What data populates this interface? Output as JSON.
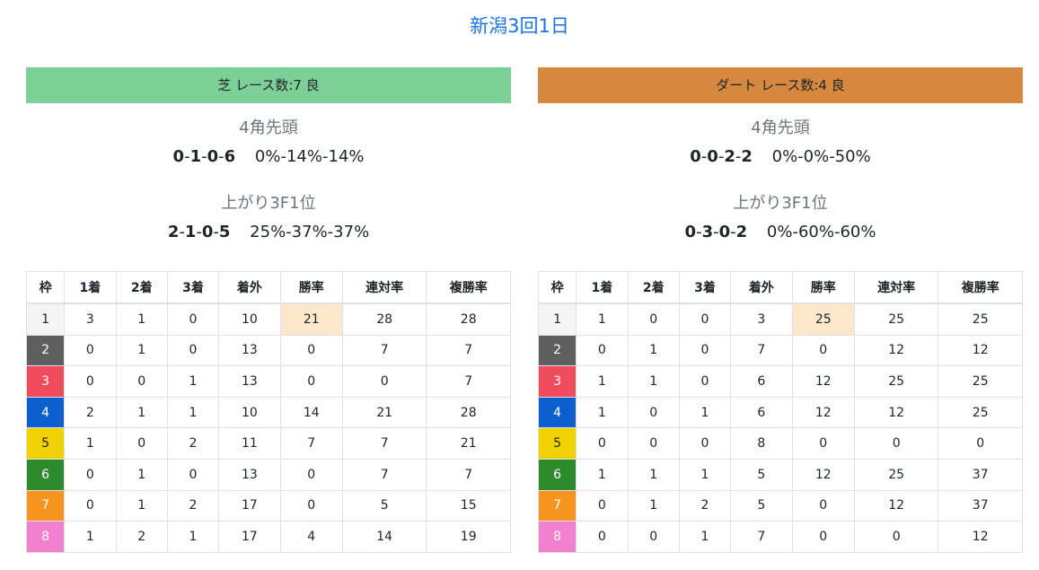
{
  "page": {
    "title": "新潟3回1日"
  },
  "turf": {
    "header": "芝 レース数:7  良",
    "corner_label": "4角先頭",
    "corner_record": [
      "0",
      "1",
      "0",
      "6"
    ],
    "corner_pct": "0%-14%-14%",
    "last3f_label": "上がり3F1位",
    "last3f_record": [
      "2",
      "1",
      "0",
      "5"
    ],
    "last3f_pct": "25%-37%-37%",
    "columns": [
      "枠",
      "1着",
      "2着",
      "3着",
      "着外",
      "勝率",
      "連対率",
      "複勝率"
    ],
    "rows": [
      [
        "1",
        "3",
        "1",
        "0",
        "10",
        "21",
        "28",
        "28"
      ],
      [
        "2",
        "0",
        "1",
        "0",
        "13",
        "0",
        "7",
        "7"
      ],
      [
        "3",
        "0",
        "0",
        "1",
        "13",
        "0",
        "0",
        "7"
      ],
      [
        "4",
        "2",
        "1",
        "1",
        "10",
        "14",
        "21",
        "28"
      ],
      [
        "5",
        "1",
        "0",
        "2",
        "11",
        "7",
        "7",
        "21"
      ],
      [
        "6",
        "0",
        "1",
        "0",
        "13",
        "0",
        "7",
        "7"
      ],
      [
        "7",
        "0",
        "1",
        "2",
        "17",
        "0",
        "5",
        "15"
      ],
      [
        "8",
        "1",
        "2",
        "1",
        "17",
        "4",
        "14",
        "19"
      ]
    ]
  },
  "dirt": {
    "header": "ダート レース数:4  良",
    "corner_label": "4角先頭",
    "corner_record": [
      "0",
      "0",
      "2",
      "2"
    ],
    "corner_pct": "0%-0%-50%",
    "last3f_label": "上がり3F1位",
    "last3f_record": [
      "0",
      "3",
      "0",
      "2"
    ],
    "last3f_pct": "0%-60%-60%",
    "columns": [
      "枠",
      "1着",
      "2着",
      "3着",
      "着外",
      "勝率",
      "連対率",
      "複勝率"
    ],
    "rows": [
      [
        "1",
        "1",
        "0",
        "0",
        "3",
        "25",
        "25",
        "25"
      ],
      [
        "2",
        "0",
        "1",
        "0",
        "7",
        "0",
        "12",
        "12"
      ],
      [
        "3",
        "1",
        "1",
        "0",
        "6",
        "12",
        "25",
        "25"
      ],
      [
        "4",
        "1",
        "0",
        "1",
        "6",
        "12",
        "12",
        "25"
      ],
      [
        "5",
        "0",
        "0",
        "0",
        "8",
        "0",
        "0",
        "0"
      ],
      [
        "6",
        "1",
        "1",
        "1",
        "5",
        "12",
        "25",
        "37"
      ],
      [
        "7",
        "0",
        "1",
        "2",
        "5",
        "0",
        "12",
        "37"
      ],
      [
        "8",
        "0",
        "0",
        "1",
        "7",
        "0",
        "0",
        "12"
      ]
    ]
  },
  "colors": {
    "title": "#1a73e8",
    "turf_header": "#7ccf96",
    "dirt_header": "#d6883f",
    "highlight": "#fde8cc",
    "waku": [
      "#f5f5f5",
      "#5f5f5f",
      "#ef4b5b",
      "#0d5ecf",
      "#f1d200",
      "#2d8b2d",
      "#f7941d",
      "#f37fd1"
    ]
  }
}
